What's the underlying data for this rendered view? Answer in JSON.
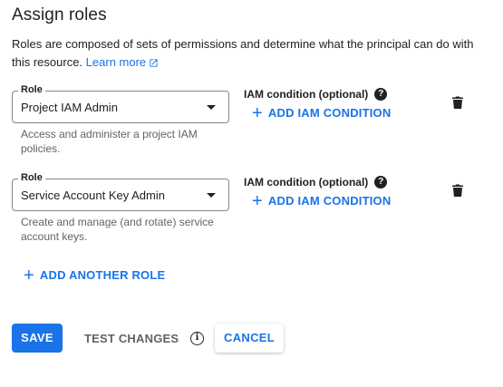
{
  "header": {
    "title": "Assign roles",
    "description": "Roles are composed of sets of permissions and determine what the principal can do with this resource.",
    "learn_more": "Learn more"
  },
  "roles": [
    {
      "field_label": "Role",
      "value": "Project IAM Admin",
      "helper": "Access and administer a project IAM policies.",
      "iam_condition_label": "IAM condition (optional)",
      "add_condition": "ADD IAM CONDITION"
    },
    {
      "field_label": "Role",
      "value": "Service Account Key Admin",
      "helper": "Create and manage (and rotate) service account keys.",
      "iam_condition_label": "IAM condition (optional)",
      "add_condition": "ADD IAM CONDITION"
    }
  ],
  "add_another_role": "ADD ANOTHER ROLE",
  "footer": {
    "save": "SAVE",
    "test_changes": "TEST CHANGES",
    "cancel": "CANCEL"
  },
  "colors": {
    "primary": "#1a73e8",
    "text": "#202124",
    "muted": "#5f6368"
  }
}
